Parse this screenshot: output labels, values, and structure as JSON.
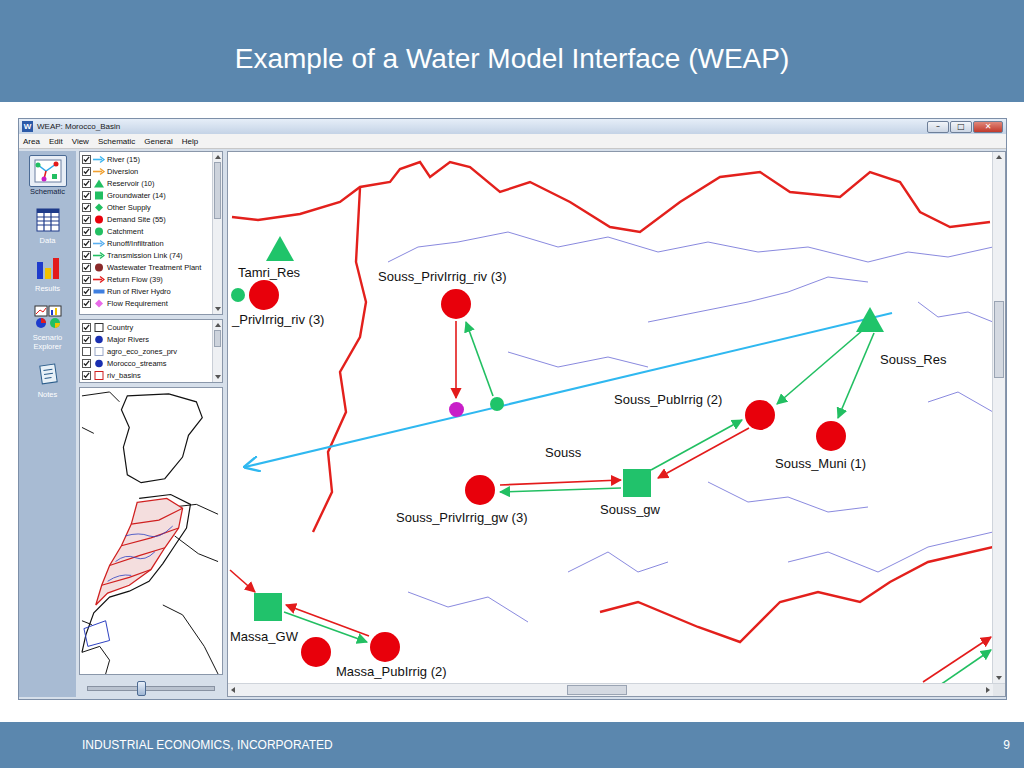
{
  "slide": {
    "title": "Example of a Water Model Interface (WEAP)",
    "footer": "INDUSTRIAL ECONOMICS, INCORPORATED",
    "page": "9"
  },
  "window": {
    "icon": "W",
    "title": "WEAP: Morocco_Basin",
    "buttons": [
      "–",
      "□",
      "✕"
    ]
  },
  "menu": [
    "Area",
    "Edit",
    "View",
    "Schematic",
    "General",
    "Help"
  ],
  "views": [
    {
      "label": "Schematic",
      "kind": "schematic",
      "selected": true
    },
    {
      "label": "Data",
      "kind": "data",
      "selected": false
    },
    {
      "label": "Results",
      "kind": "results",
      "selected": false
    },
    {
      "label": "Scenario Explorer",
      "kind": "scenarios",
      "selected": false
    },
    {
      "label": "Notes",
      "kind": "notes",
      "selected": false
    }
  ],
  "legend": {
    "scroll": 0,
    "items": [
      {
        "label": "River (15)",
        "checked": true,
        "kind": "river"
      },
      {
        "label": "Diversion",
        "checked": true,
        "kind": "diversion"
      },
      {
        "label": "Reservoir (10)",
        "checked": true,
        "kind": "reservoir"
      },
      {
        "label": "Groundwater (14)",
        "checked": true,
        "kind": "groundwater"
      },
      {
        "label": "Other Supply",
        "checked": true,
        "kind": "other-supply"
      },
      {
        "label": "Demand Site (55)",
        "checked": true,
        "kind": "demand"
      },
      {
        "label": "Catchment",
        "checked": true,
        "kind": "catchment"
      },
      {
        "label": "Runoff/Infiltration",
        "checked": true,
        "kind": "runoff"
      },
      {
        "label": "Transmission Link (74)",
        "checked": true,
        "kind": "transmission"
      },
      {
        "label": "Wastewater Treatment Plant",
        "checked": true,
        "kind": "treatment-plant"
      },
      {
        "label": "Return Flow (39)",
        "checked": true,
        "kind": "return"
      },
      {
        "label": "Run of River Hydro",
        "checked": true,
        "kind": "run-of-river"
      },
      {
        "label": "Flow Requirement",
        "checked": true,
        "kind": "flow-requirement"
      }
    ]
  },
  "layers": {
    "scroll": 0,
    "items": [
      {
        "label": "Country",
        "checked": true,
        "kind": "polygon",
        "color": "#333333"
      },
      {
        "label": "Major Rivers",
        "checked": true,
        "kind": "point",
        "color": "#1a2fb0"
      },
      {
        "label": "agro_eco_zones_prv",
        "checked": false,
        "kind": "polygon",
        "color": "#9aa7c7"
      },
      {
        "label": "Morocco_streams",
        "checked": true,
        "kind": "point",
        "color": "#1a2fb0"
      },
      {
        "label": "riv_basins",
        "checked": true,
        "kind": "polygon",
        "color": "#d02020"
      }
    ]
  },
  "zoom_slider": {
    "level": 0.42
  },
  "map": {
    "region_labels": [
      "Souss"
    ],
    "scroll": {
      "vertical": 0.32,
      "horizontal": 0.48
    },
    "nodes": [
      {
        "kind": "reservoir",
        "label": "Tamri_Res"
      },
      {
        "kind": "catchment",
        "label": ""
      },
      {
        "kind": "demand",
        "label": "_PrivIrrig_riv (3)"
      },
      {
        "kind": "demand",
        "label": "Souss_PrivIrrig_riv (3)"
      },
      {
        "kind": "diversion",
        "label": ""
      },
      {
        "kind": "catchment",
        "label": ""
      },
      {
        "kind": "reservoir",
        "label": "Souss_Res"
      },
      {
        "kind": "demand",
        "label": "Souss_PubIrrig (2)"
      },
      {
        "kind": "demand",
        "label": "Souss_Muni (1)"
      },
      {
        "kind": "groundwater",
        "label": "Souss_gw"
      },
      {
        "kind": "demand",
        "label": "Souss_PrivIrrig_gw (3)"
      },
      {
        "kind": "groundwater",
        "label": "Massa_GW"
      },
      {
        "kind": "demand",
        "label": ""
      },
      {
        "kind": "demand",
        "label": "Massa_PubIrrig (2)"
      }
    ],
    "links": [
      {
        "kind": "transmission"
      },
      {
        "kind": "transmission"
      },
      {
        "kind": "transmission"
      },
      {
        "kind": "return"
      },
      {
        "kind": "transmission"
      },
      {
        "kind": "return"
      },
      {
        "kind": "return"
      },
      {
        "kind": "transmission"
      },
      {
        "kind": "return"
      },
      {
        "kind": "transmission"
      },
      {
        "kind": "return"
      },
      {
        "kind": "return"
      },
      {
        "kind": "transmission"
      }
    ]
  }
}
